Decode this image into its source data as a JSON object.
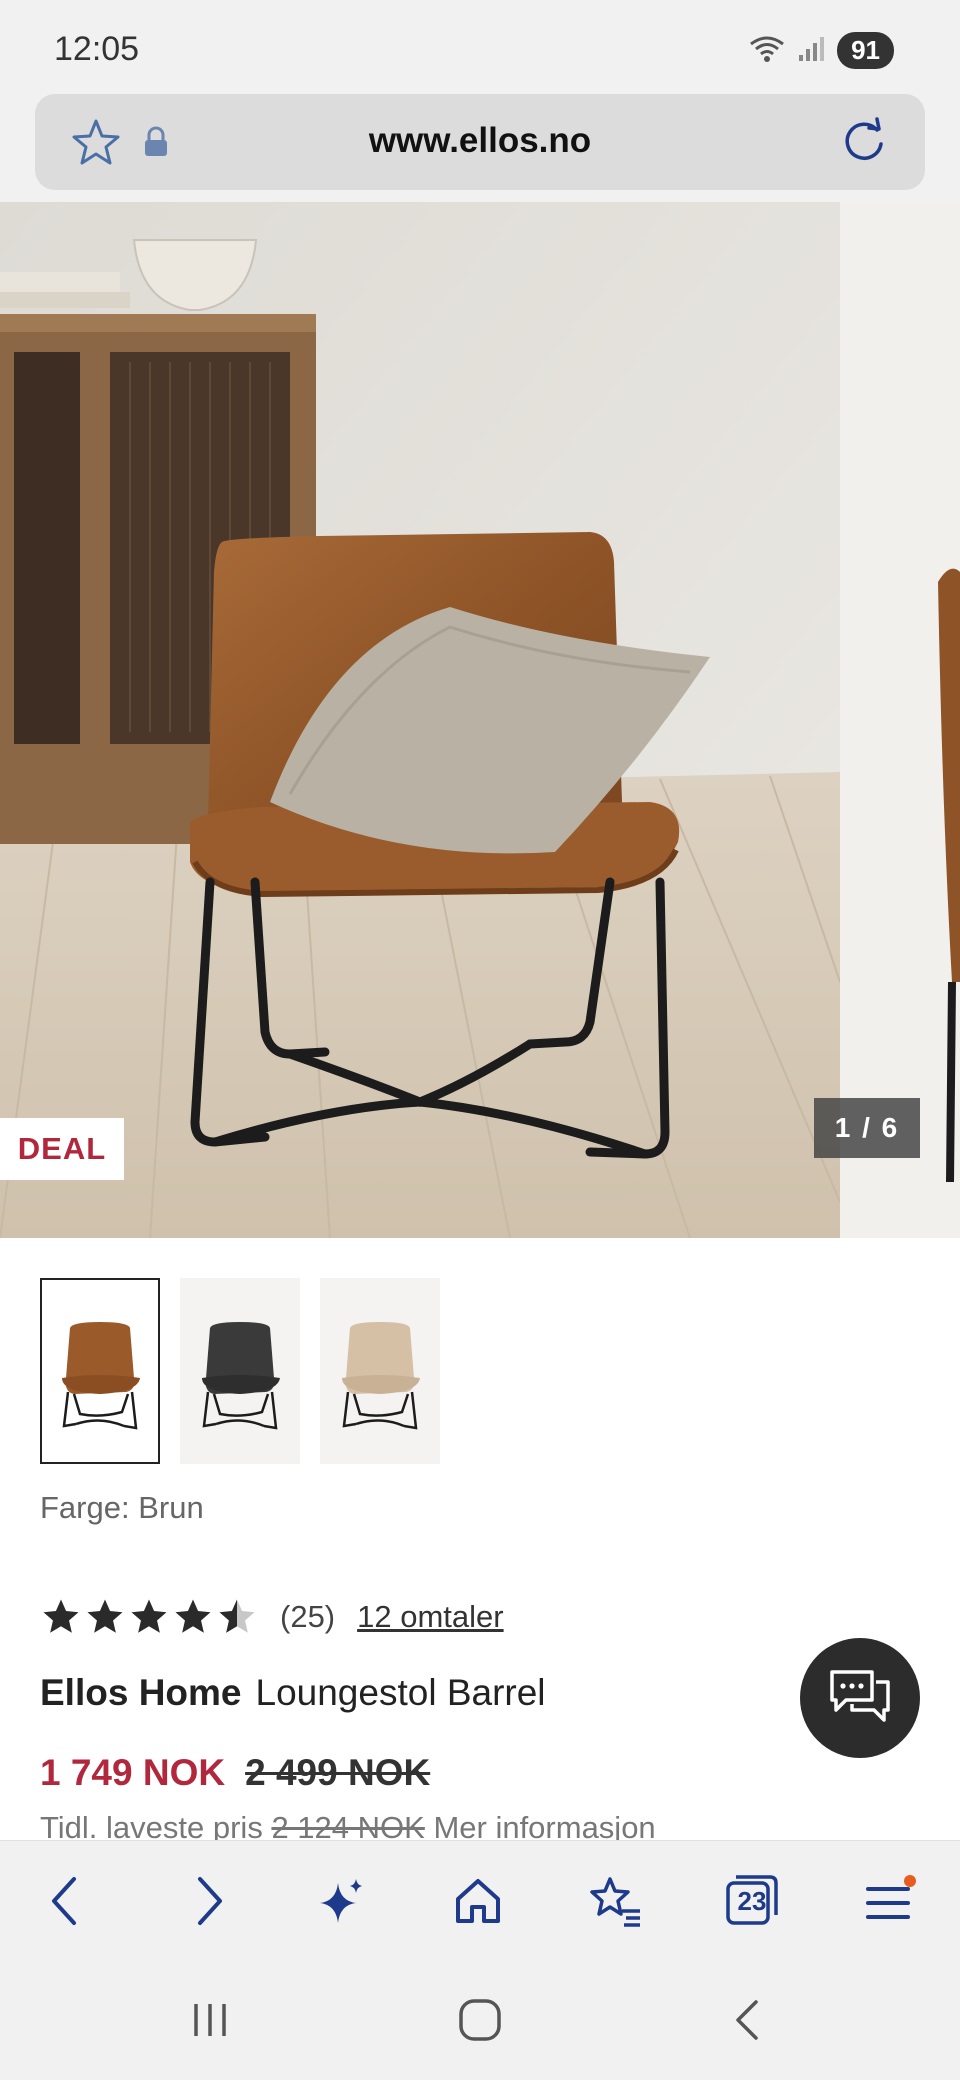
{
  "status": {
    "time": "12:05",
    "battery": "91"
  },
  "browser": {
    "url": "www.ellos.no",
    "tab_count": "23"
  },
  "gallery": {
    "badge": "DEAL",
    "counter": "1 / 6"
  },
  "colors_label": "Farge: Brun",
  "rating": {
    "stars": 4.5,
    "count": "(25)",
    "reviews_link": "12 omtaler"
  },
  "product": {
    "brand": "Ellos Home",
    "name": "Loungestol Barrel"
  },
  "price": {
    "current": "1 749 NOK",
    "original": "2 499 NOK",
    "lowest_prefix": "Tidl. laveste pris",
    "lowest_value": "2 124 NOK",
    "more_info": "Mer informasjon"
  },
  "theme": {
    "accent": "#b1283c",
    "icon_blue": "#1e3a8a"
  },
  "icons": [
    "wifi-icon",
    "signal-icon",
    "star-icon",
    "lock-icon",
    "reload-icon",
    "back-icon",
    "forward-icon",
    "sparkle-icon",
    "home-icon",
    "bookmarks-icon",
    "tabs-icon",
    "menu-icon",
    "chat-icon"
  ]
}
